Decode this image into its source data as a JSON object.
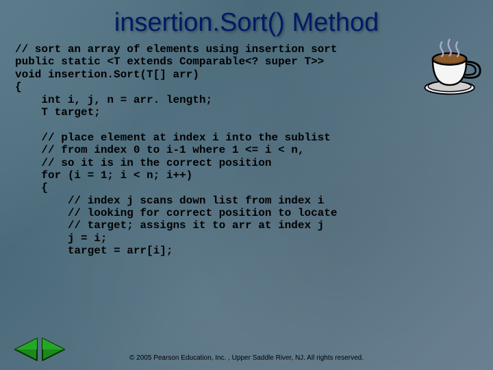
{
  "title": "insertion.Sort() Method",
  "code": "// sort an array of elements using insertion sort\npublic static <T extends Comparable<? super T>>\nvoid insertion.Sort(T[] arr)\n{\n    int i, j, n = arr. length;\n    T target;\n\n    // place element at index i into the sublist\n    // from index 0 to i-1 where 1 <= i < n,\n    // so it is in the correct position\n    for (i = 1; i < n; i++)\n    {\n        // index j scans down list from index i\n        // looking for correct position to locate\n        // target; assigns it to arr at index j\n        j = i;\n        target = arr[i];",
  "footer": "© 2005 Pearson Education, Inc. , Upper Saddle River, NJ.  All rights reserved.",
  "icons": {
    "prev": "prev-arrow",
    "next": "next-arrow",
    "cup": "coffee-cup"
  }
}
